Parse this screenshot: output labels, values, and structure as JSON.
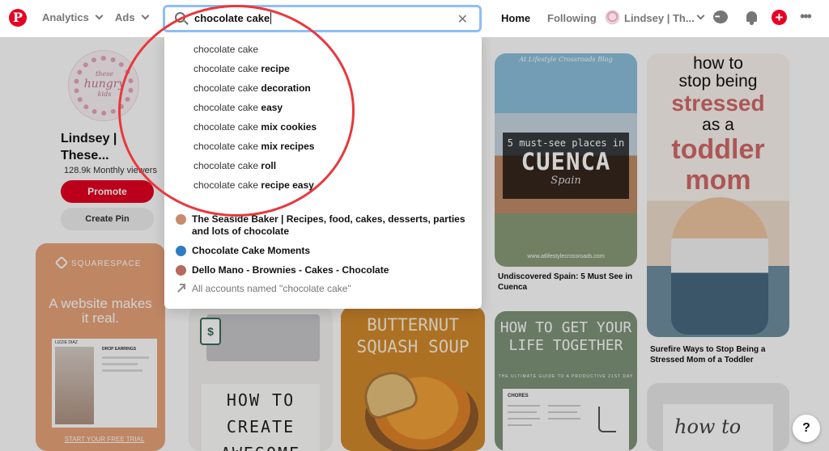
{
  "topbar": {
    "logo_glyph": "P",
    "menus": [
      {
        "label": "Analytics"
      },
      {
        "label": "Ads"
      }
    ],
    "search": {
      "value": "chocolate cake",
      "clear_glyph": "✕"
    },
    "nav": {
      "home": "Home",
      "following": "Following",
      "account": "Lindsey | Th..."
    },
    "plus_glyph": "+",
    "more_glyph": "•••"
  },
  "dropdown": {
    "query": "chocolate cake",
    "suggestions": [
      {
        "base": "chocolate cake",
        "suffix": ""
      },
      {
        "base": "chocolate cake",
        "suffix": "recipe"
      },
      {
        "base": "chocolate cake",
        "suffix": "decoration"
      },
      {
        "base": "chocolate cake",
        "suffix": "easy"
      },
      {
        "base": "chocolate cake",
        "suffix": "mix cookies"
      },
      {
        "base": "chocolate cake",
        "suffix": "mix recipes"
      },
      {
        "base": "chocolate cake",
        "suffix": "roll"
      },
      {
        "base": "chocolate cake",
        "suffix": "recipe easy"
      }
    ],
    "accounts": [
      {
        "name": "The Seaside Baker | Recipes, food, cakes, desserts, parties and lots of chocolate",
        "avatar_color": "#c98b6b"
      },
      {
        "name": "Chocolate Cake Moments",
        "avatar_color": "#2f7dc1"
      },
      {
        "name": "Dello Mano - Brownies - Cakes - Chocolate",
        "avatar_color": "#b46a5c"
      }
    ],
    "all_accounts": "All accounts named \"chocolate cake\""
  },
  "profile": {
    "avatar_text": [
      "these",
      "hungry",
      "kids"
    ],
    "name": "Lindsey | These...",
    "stat": "128.9k Monthly viewers",
    "promote": "Promote",
    "create_pin": "Create Pin"
  },
  "pins": {
    "squarespace": {
      "brand": "SQUARESPACE",
      "headline": "A website makes it real.",
      "mock_name": "LIZZIE DIAZ",
      "mock_label": "DROP EARRINGS",
      "cta": "START YOUR FREE TRIAL"
    },
    "howto_create": {
      "icon_glyph": "$",
      "title": "HOW TO CREATE AWESOME"
    },
    "soup": {
      "title": "BUTTERNUT SQUASH SOUP"
    },
    "cuenca": {
      "top": "At Lifestyle Crossroads Blog",
      "line1": "5 must-see places in",
      "line2": "CUENCA",
      "line3": "Spain",
      "url": "www.atlifestylecrossroads.com",
      "caption": "Undiscovered Spain: 5 Must See in Cuenca"
    },
    "life": {
      "title": "HOW TO GET YOUR LIFE TOGETHER",
      "sub": "THE ULTIMATE GUIDE TO A PRODUCTIVE 21ST DAY",
      "chores": "CHORES"
    },
    "toddler": {
      "l1": "how to",
      "l2": "stop being",
      "l3": "stressed",
      "l4": "as a",
      "l5": "toddler",
      "l6": "mom",
      "caption": "Surefire Ways to Stop Being a Stressed Mom of a Toddler"
    },
    "howto_script": {
      "text": "how to"
    }
  },
  "help": "?",
  "colors": {
    "brand_red": "#e60023",
    "search_border": "#8ebef5",
    "annotation": "#e8383d"
  }
}
